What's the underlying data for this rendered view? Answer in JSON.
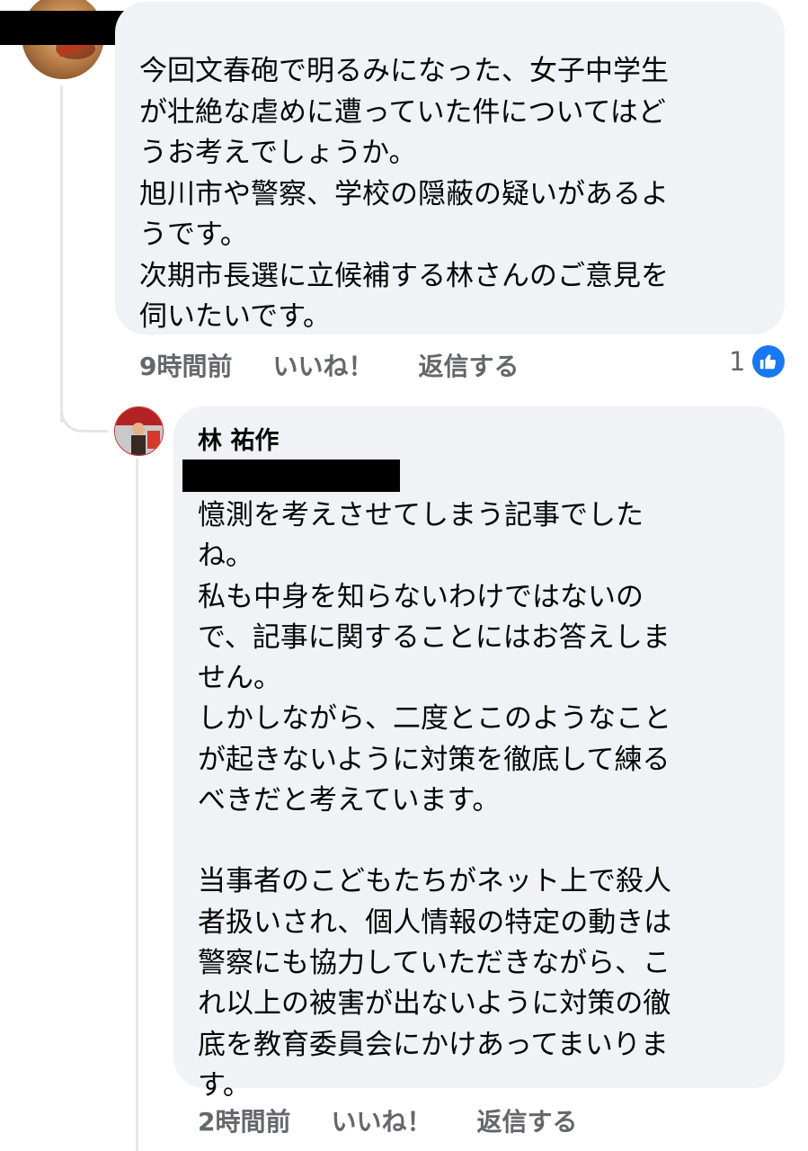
{
  "comment1": {
    "lines": [
      "今回文春砲で明るみになった、女子中学生",
      "が壮絶な虐めに遭っていた件についてはど",
      "うお考えでしょうか。",
      "旭川市や警察、学校の隠蔽の疑いがあるよ",
      "うです。",
      "次期市長選に立候補する林さんのご意見を",
      "伺いたいです。"
    ],
    "time": "9時間前",
    "like_label": "いいね！",
    "reply_label": "返信する",
    "reaction_count": "1",
    "reaction_icon": "thumbs-up-icon"
  },
  "reply1": {
    "author": "林 祐作",
    "lines": [
      "憶測を考えさせてしまう記事でした",
      "ね。",
      "私も中身を知らないわけではないの",
      "で、記事に関することにはお答えしま",
      "せん。",
      "しかしながら、二度とこのようなこと",
      "が起きないように対策を徹底して練る",
      "べきだと考えています。",
      "",
      "当事者のこどもたちがネット上で殺人",
      "者扱いされ、個人情報の特定の動きは",
      "警察にも協力していただきながら、こ",
      "れ以上の被害が出ないように対策の徹",
      "底を教育委員会にかけあってまいりま",
      "す。"
    ],
    "time": "2時間前",
    "like_label": "いいね！",
    "reply_label": "返信する"
  },
  "colors": {
    "bubble": "#f0f2f5",
    "meta_text": "#65676b",
    "like_blue": "#1877f2",
    "thread_line": "#e4e6eb"
  }
}
